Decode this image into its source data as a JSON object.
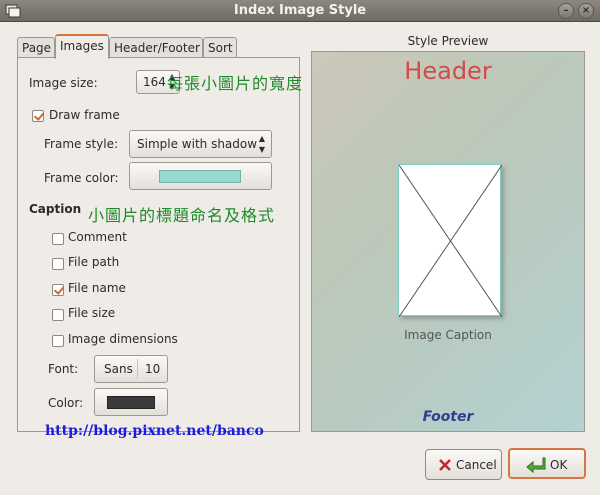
{
  "window": {
    "title": "Index Image Style"
  },
  "tabs": [
    {
      "label": "Page"
    },
    {
      "label": "Images"
    },
    {
      "label": "Header/Footer"
    },
    {
      "label": "Sort"
    }
  ],
  "image_size": {
    "label": "Image size:",
    "value": "164",
    "annotation": "每張小圖片的寬度"
  },
  "draw_frame": {
    "label": "Draw frame",
    "checked": true
  },
  "frame_style": {
    "label": "Frame style:",
    "value": "Simple with shadow"
  },
  "frame_color": {
    "label": "Frame color:",
    "color": "#9ad8cf"
  },
  "caption": {
    "title": "Caption",
    "annotation": "小圖片的標題命名及格式",
    "options": [
      {
        "label": "Comment",
        "checked": false
      },
      {
        "label": "File path",
        "checked": false
      },
      {
        "label": "File name",
        "checked": true
      },
      {
        "label": "File size",
        "checked": false
      },
      {
        "label": "Image dimensions",
        "checked": false
      }
    ],
    "font_label": "Font:",
    "font_name": "Sans",
    "font_size": "10",
    "color_label": "Color:",
    "color": "#3a3a3a"
  },
  "url": "http://blog.pixnet.net/banco",
  "preview": {
    "label": "Style Preview",
    "header": "Header",
    "caption": "Image Caption",
    "footer": "Footer"
  },
  "buttons": {
    "cancel": "Cancel",
    "ok": "OK"
  }
}
